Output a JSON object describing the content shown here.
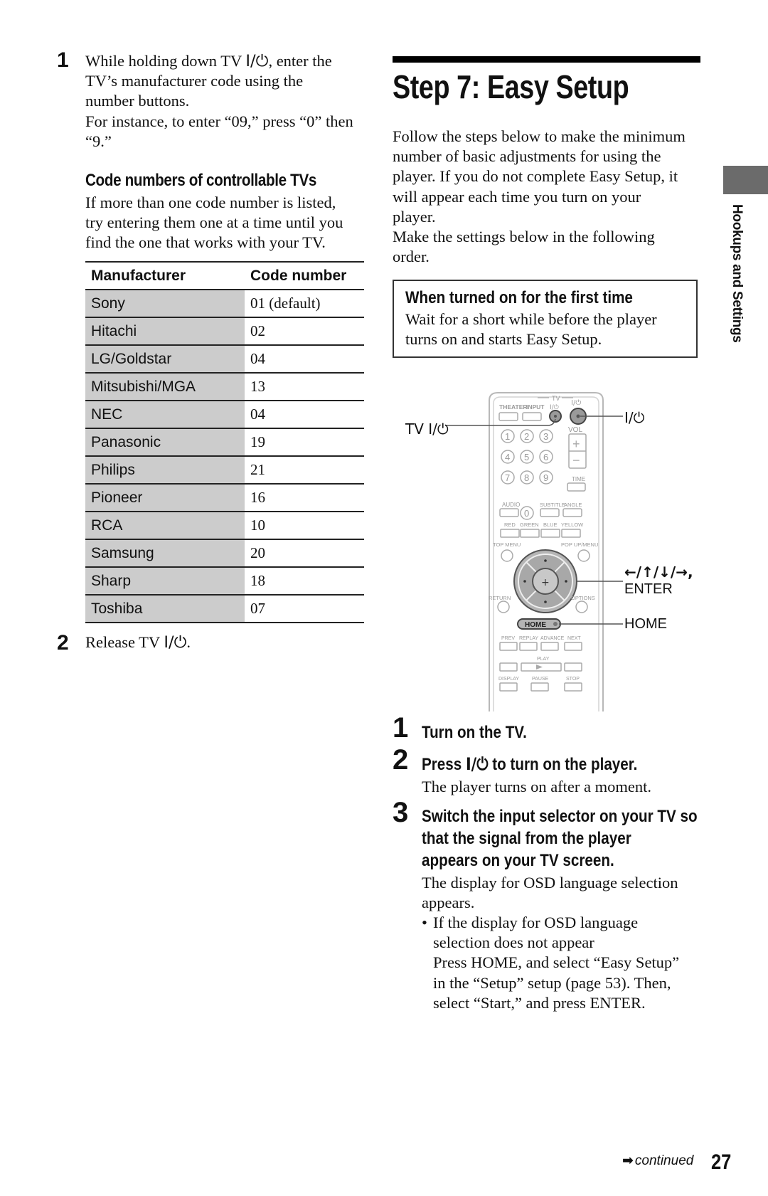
{
  "power_symbol": "I/⏻",
  "left": {
    "step1": {
      "number": "1",
      "line1_pre": "While holding down TV ",
      "line1_post": ", enter the",
      "line2": "TV’s manufacturer code using the",
      "line3": "number buttons.",
      "line4": "For instance, to enter “09,” press “0” then",
      "line5": "“9.”"
    },
    "code_section": {
      "heading": "Code numbers of controllable TVs",
      "paragraph_lines": [
        "If more than one code number is listed,",
        "try entering them one at a time until you",
        "find the one that works with your TV."
      ]
    },
    "table": {
      "headers": [
        "Manufacturer",
        "Code number"
      ],
      "rows": [
        {
          "manufacturer": "Sony",
          "code": "01 (default)"
        },
        {
          "manufacturer": "Hitachi",
          "code": "02"
        },
        {
          "manufacturer": "LG/Goldstar",
          "code": "04"
        },
        {
          "manufacturer": "Mitsubishi/MGA",
          "code": "13"
        },
        {
          "manufacturer": "NEC",
          "code": "04"
        },
        {
          "manufacturer": "Panasonic",
          "code": "19"
        },
        {
          "manufacturer": "Philips",
          "code": "21"
        },
        {
          "manufacturer": "Pioneer",
          "code": "16"
        },
        {
          "manufacturer": "RCA",
          "code": "10"
        },
        {
          "manufacturer": "Samsung",
          "code": "20"
        },
        {
          "manufacturer": "Sharp",
          "code": "18"
        },
        {
          "manufacturer": "Toshiba",
          "code": "07"
        }
      ]
    },
    "step2": {
      "number": "2",
      "text_pre": "Release TV ",
      "text_post": "."
    }
  },
  "right": {
    "title": "Step 7: Easy Setup",
    "intro_lines": [
      "Follow the steps below to make the minimum",
      "number of basic adjustments for using the",
      "player. If you do not complete Easy Setup, it",
      "will appear each time you turn on your",
      "player.",
      "Make the settings below in the following",
      "order."
    ],
    "note": {
      "title": "When turned on for the first time",
      "lines": [
        "Wait for a short while before the player",
        "turns on and starts Easy Setup."
      ]
    },
    "remote": {
      "callouts": {
        "tv_power": "TV I/⏻",
        "power": "I/⏻",
        "arrows": "←/↑/↓/→,",
        "enter": "ENTER",
        "home": "HOME"
      },
      "labels": {
        "tv_group": "TV",
        "theater": "THEATER",
        "input": "INPUT",
        "tv_power": "I/⏻",
        "power": "I/⏻",
        "vol": "VOL",
        "time": "TIME",
        "audio": "AUDIO",
        "subtitle": "SUBTITLE",
        "angle": "ANGLE",
        "red": "RED",
        "green": "GREEN",
        "blue": "BLUE",
        "yellow": "YELLOW",
        "top_menu": "TOP MENU",
        "popup_menu": "POP UP/MENU",
        "return": "RETURN",
        "options": "OPTIONS",
        "home": "HOME",
        "prev": "PREV",
        "replay": "REPLAY",
        "advance": "ADVANCE",
        "next": "NEXT",
        "play": "PLAY",
        "display": "DISPLAY",
        "pause": "PAUSE",
        "stop": "STOP"
      },
      "digits": [
        "1",
        "2",
        "3",
        "4",
        "5",
        "6",
        "7",
        "8",
        "9",
        "0"
      ]
    },
    "steps": [
      {
        "number": "1",
        "heading": "Turn on the TV."
      },
      {
        "number": "2",
        "heading_pre": "Press ",
        "heading_post": " to turn on the player.",
        "text": "The player turns on after a moment."
      },
      {
        "number": "3",
        "heading_lines": [
          "Switch the input selector on your TV so",
          "that the signal from the player",
          "appears on your TV screen."
        ],
        "text_lines": [
          "The display for OSD language selection",
          "appears."
        ],
        "bullet": "•",
        "bullet_lines": [
          "If the display for OSD language",
          "selection does not appear",
          "Press HOME, and select “Easy Setup”",
          "in the “Setup” setup (page 53). Then,",
          "select “Start,” and press ENTER."
        ]
      }
    ]
  },
  "side_tab": {
    "label": "Hookups and Settings",
    "color": "#6b6b6b"
  },
  "footer": {
    "continued_arrow": "➡",
    "continued": "continued",
    "page_number": "27"
  }
}
